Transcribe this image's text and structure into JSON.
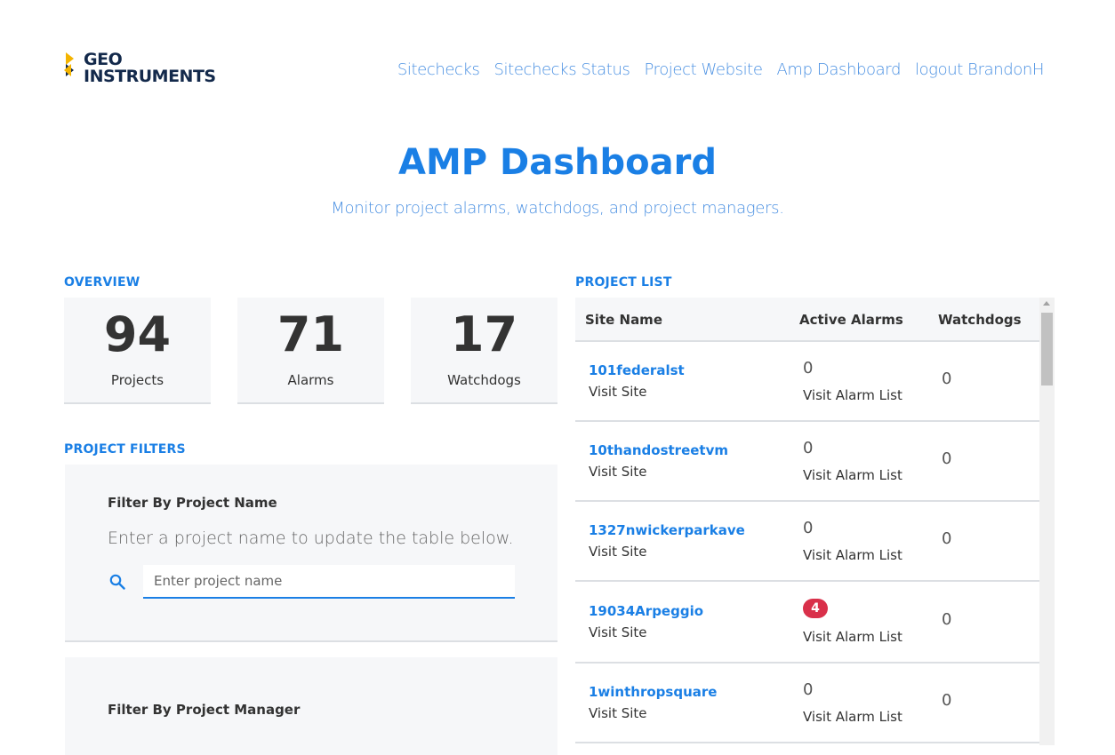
{
  "brand": {
    "line1": "GEO",
    "line2": "INSTRUMENTS"
  },
  "nav": [
    {
      "label": "Sitechecks"
    },
    {
      "label": "Sitechecks Status"
    },
    {
      "label": "Project Website"
    },
    {
      "label": "Amp Dashboard"
    },
    {
      "label": "logout BrandonH"
    }
  ],
  "hero": {
    "title": "AMP Dashboard",
    "subtitle": "Monitor project alarms, watchdogs, and project managers."
  },
  "overview": {
    "title": "OVERVIEW",
    "stats": [
      {
        "value": "94",
        "label": "Projects"
      },
      {
        "value": "71",
        "label": "Alarms"
      },
      {
        "value": "17",
        "label": "Watchdogs"
      }
    ]
  },
  "filters": {
    "title": "PROJECT FILTERS",
    "by_name": {
      "heading": "Filter By Project Name",
      "hint": "Enter a project name to update the table below.",
      "placeholder": "Enter project name",
      "value": ""
    },
    "by_manager": {
      "heading": "Filter By Project Manager"
    }
  },
  "project_list": {
    "title": "PROJECT LIST",
    "columns": [
      "Site Name",
      "Active Alarms",
      "Watchdogs"
    ],
    "rows": [
      {
        "site": "101federalst",
        "visit": "Visit Site",
        "alarms": "0",
        "alarm_link": "Visit Alarm List",
        "watchdogs": "0",
        "alert": false
      },
      {
        "site": "10thandostreetvm",
        "visit": "Visit Site",
        "alarms": "0",
        "alarm_link": "Visit Alarm List",
        "watchdogs": "0",
        "alert": false
      },
      {
        "site": "1327nwickerparkave",
        "visit": "Visit Site",
        "alarms": "0",
        "alarm_link": "Visit Alarm List",
        "watchdogs": "0",
        "alert": false
      },
      {
        "site": "19034Arpeggio",
        "visit": "Visit Site",
        "alarms": "4",
        "alarm_link": "Visit Alarm List",
        "watchdogs": "0",
        "alert": true
      },
      {
        "site": "1winthropsquare",
        "visit": "Visit Site",
        "alarms": "0",
        "alarm_link": "Visit Alarm List",
        "watchdogs": "0",
        "alert": false
      }
    ]
  },
  "colors": {
    "accent": "#1a7fe5",
    "link": "#4a90e2",
    "alert": "#d9304a",
    "panel": "#f6f7f9"
  }
}
